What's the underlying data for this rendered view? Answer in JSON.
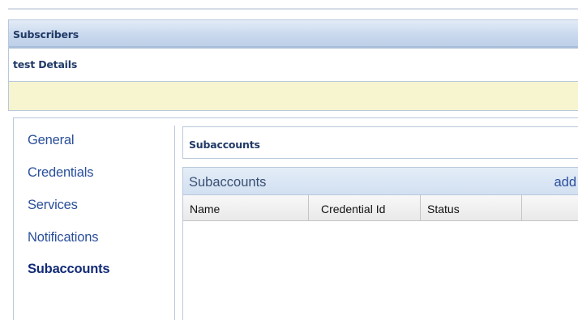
{
  "header": {
    "title": "Subscribers"
  },
  "details": {
    "title": "test Details"
  },
  "nav": {
    "items": [
      {
        "label": "General",
        "active": false
      },
      {
        "label": "Credentials",
        "active": false
      },
      {
        "label": "Services",
        "active": false
      },
      {
        "label": "Notifications",
        "active": false
      },
      {
        "label": "Subaccounts",
        "active": true
      }
    ]
  },
  "section": {
    "title": "Subaccounts"
  },
  "grid": {
    "title": "Subaccounts",
    "add_label": "add",
    "columns": [
      "Name",
      "Credential Id",
      "Status",
      ""
    ],
    "rows": []
  },
  "colors": {
    "header_bg": "#c8d8ed",
    "title_text": "#213a66",
    "nav_link": "#2a4f9a",
    "nav_active": "#122b78",
    "message_bg": "#f7f5d0",
    "border": "#b8c8dc"
  }
}
